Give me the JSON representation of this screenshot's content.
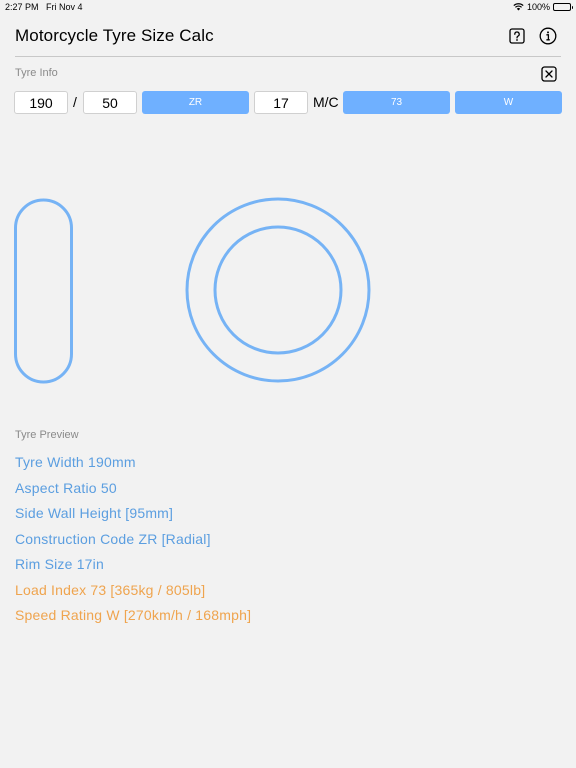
{
  "status_bar": {
    "time": "2:27 PM",
    "date": "Fri Nov 4",
    "battery": "100%",
    "battery_level": 1.0
  },
  "header": {
    "title": "Motorcycle Tyre Size Calc",
    "help_icon": "question-mark-icon",
    "info_icon": "info-circle-icon"
  },
  "tyre_info": {
    "label": "Tyre Info",
    "width_value": "190",
    "separator": "/",
    "aspect_value": "50",
    "construction_label": "ZR",
    "rim_value": "17",
    "mc_text": "M/C",
    "load_index_label": "73",
    "speed_rating_label": "W",
    "clear_icon": "close-box-icon"
  },
  "tyre_preview": {
    "label": "Tyre Preview",
    "lines": [
      "Tyre Width 190mm",
      "Aspect Ratio 50",
      "Side Wall Height [95mm]",
      "Construction Code ZR [Radial]",
      "Rim Size 17in",
      "Load Index 73 [365kg / 805lb]",
      "Speed Rating W [270km/h / 168mph]"
    ]
  },
  "colors": {
    "accent_blue": "#6fb0ff",
    "text_blue": "#5b9ee0",
    "text_orange": "#efa44e",
    "background": "#f2f2f2"
  }
}
